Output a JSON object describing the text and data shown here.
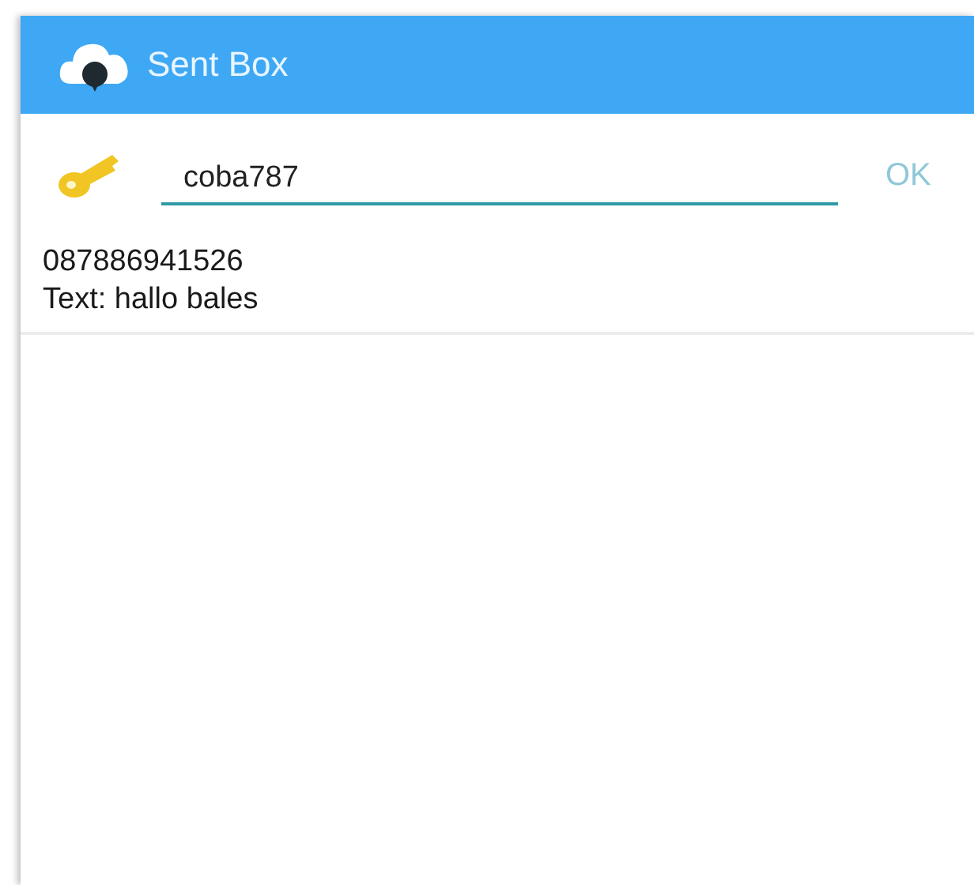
{
  "app_bar": {
    "title": "Sent Box"
  },
  "password_row": {
    "value": "coba787",
    "button": "OK"
  },
  "messages": [
    {
      "number": "087886941526",
      "text": "Text: hallo bales"
    }
  ]
}
